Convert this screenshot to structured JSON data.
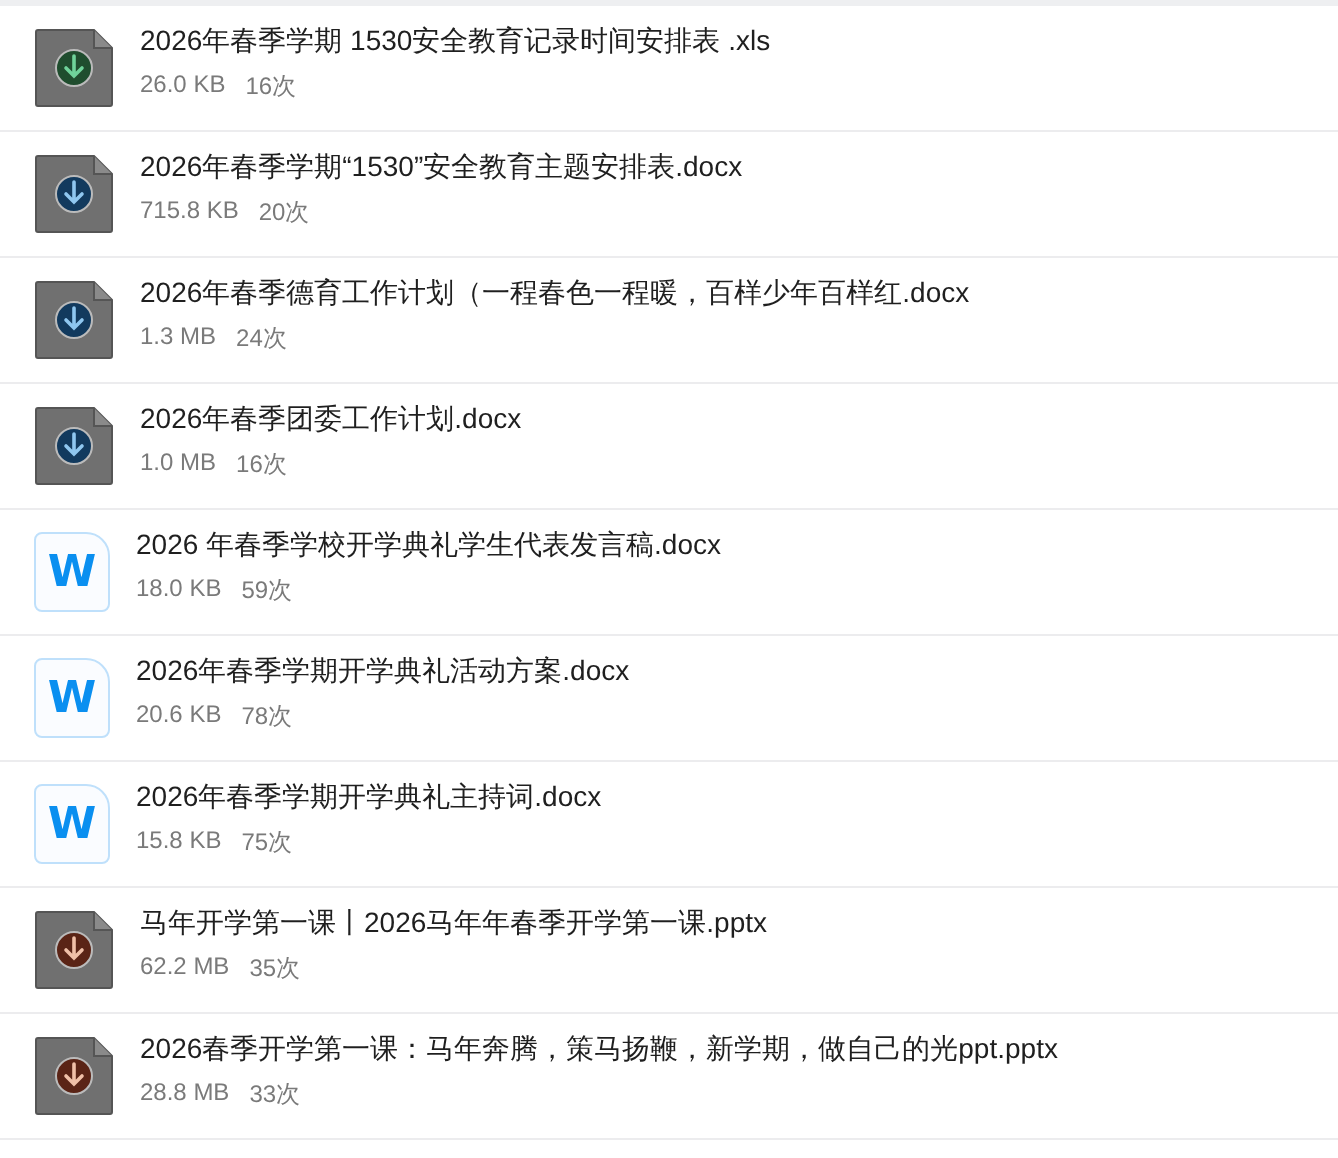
{
  "files": [
    {
      "kind": "sheet",
      "name": "2026年春季学期 1530安全教育记录时间安排表 .xls",
      "size": "26.0 KB",
      "count": "16次"
    },
    {
      "kind": "doc",
      "name": "2026年春季学期“1530”安全教育主题安排表.docx",
      "size": "715.8 KB",
      "count": "20次"
    },
    {
      "kind": "doc",
      "name": "2026年春季德育工作计划（一程春色一程暖，百样少年百样红.docx",
      "size": "1.3 MB",
      "count": "24次"
    },
    {
      "kind": "doc",
      "name": "2026年春季团委工作计划.docx",
      "size": "1.0 MB",
      "count": "16次"
    },
    {
      "kind": "word",
      "glyph": "W",
      "name": "2026 年春季学校开学典礼学生代表发言稿.docx",
      "size": "18.0 KB",
      "count": "59次"
    },
    {
      "kind": "word",
      "glyph": "W",
      "name": "2026年春季学期开学典礼活动方案.docx",
      "size": "20.6 KB",
      "count": "78次"
    },
    {
      "kind": "word",
      "glyph": "W",
      "name": "2026年春季学期开学典礼主持词.docx",
      "size": "15.8 KB",
      "count": "75次"
    },
    {
      "kind": "slides",
      "name": "马年开学第一课丨2026马年年春季开学第一课.pptx",
      "size": "62.2 MB",
      "count": "35次"
    },
    {
      "kind": "slides",
      "name": "2026春季开学第一课：马年奔腾，策马扬鞭，新学期，做自己的光ppt.pptx",
      "size": "28.8 MB",
      "count": "33次"
    }
  ]
}
